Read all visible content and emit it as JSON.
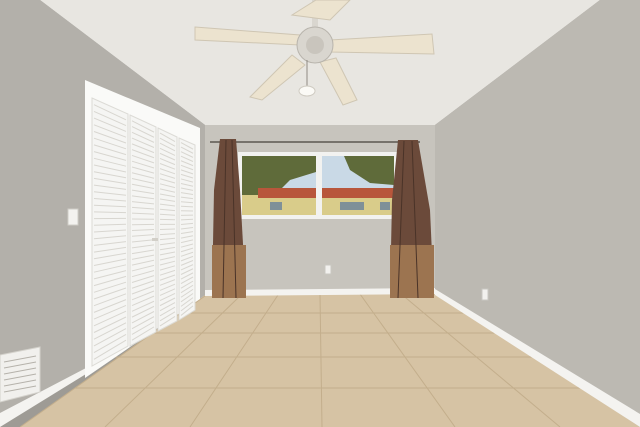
{
  "scene": {
    "colors": {
      "ceiling": "#e8e6e1",
      "left_wall": "#b3b0aa",
      "back_wall": "#c7c4bd",
      "right_wall": "#bcb9b2",
      "floor": "#d6c3a4",
      "floor_grout": "#c3ae8c",
      "baseboard": "#f4f3f0",
      "closet_door": "#f5f5f3",
      "curtain": "#6b4a3a",
      "curtain_light": "#9c7450",
      "window_frame": "#f2f2f0",
      "sky": "#c9d9e6",
      "roof": "#b8563b",
      "house_wall": "#d9cc8a",
      "foliage": "#5f6b3a",
      "fan_blade": "#ece3cf",
      "fan_metal": "#d9d6cf"
    }
  }
}
